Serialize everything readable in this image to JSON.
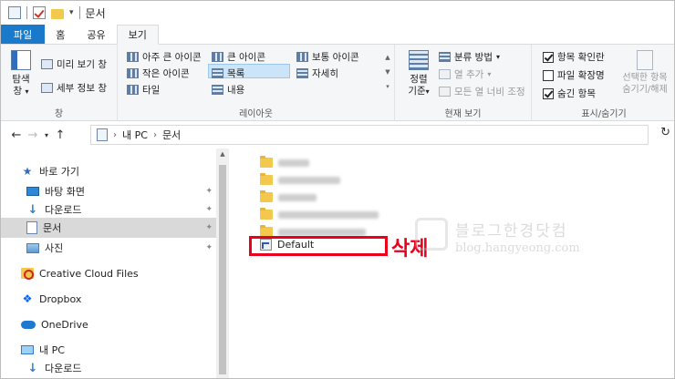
{
  "window": {
    "title": "문서"
  },
  "tabs": [
    {
      "label": "파일"
    },
    {
      "label": "홈"
    },
    {
      "label": "공유"
    },
    {
      "label": "보기"
    }
  ],
  "ribbon": {
    "panes": {
      "navigation_pane": "탐색\n창",
      "navigation_pane_a": "탐색",
      "navigation_pane_b": "창",
      "preview": "미리 보기 창",
      "details": "세부 정보 창",
      "label": "창"
    },
    "layout": {
      "items": [
        "아주 큰 아이콘",
        "큰 아이콘",
        "보통 아이콘",
        "작은 아이콘",
        "목록",
        "자세히",
        "타일",
        "내용"
      ],
      "label": "레이아웃"
    },
    "current_view": {
      "sort_a": "정렬",
      "sort_b": "기준",
      "group_by": "분류 방법",
      "add_column": "열 추가",
      "fit_columns": "모든 열 너비 조정",
      "label": "현재 보기"
    },
    "show_hide": {
      "item_checkboxes": "항목 확인란",
      "file_extensions": "파일 확장명",
      "hidden_items": "숨긴 항목",
      "hide_selected_a": "선택한 항목",
      "hide_selected_b": "숨기기/해제",
      "label": "표시/숨기기"
    }
  },
  "address": {
    "segments": [
      "내 PC",
      "문서"
    ]
  },
  "sidebar": {
    "items": [
      {
        "label": "바로 가기"
      },
      {
        "label": "바탕 화면"
      },
      {
        "label": "다운로드"
      },
      {
        "label": "문서"
      },
      {
        "label": "사진"
      },
      {
        "label": "Creative Cloud Files"
      },
      {
        "label": "Dropbox"
      },
      {
        "label": "OneDrive"
      },
      {
        "label": "내 PC"
      },
      {
        "label": "다운로드"
      }
    ]
  },
  "main": {
    "highlighted_file": "Default",
    "annotation": "삭제",
    "watermark_line1": "블로그한경닷컴",
    "watermark_line2": "blog.hangyeong.com"
  },
  "colors": {
    "file_tab": "#1979ca",
    "annotation": "#e8001c",
    "folder": "#f3c94d"
  }
}
